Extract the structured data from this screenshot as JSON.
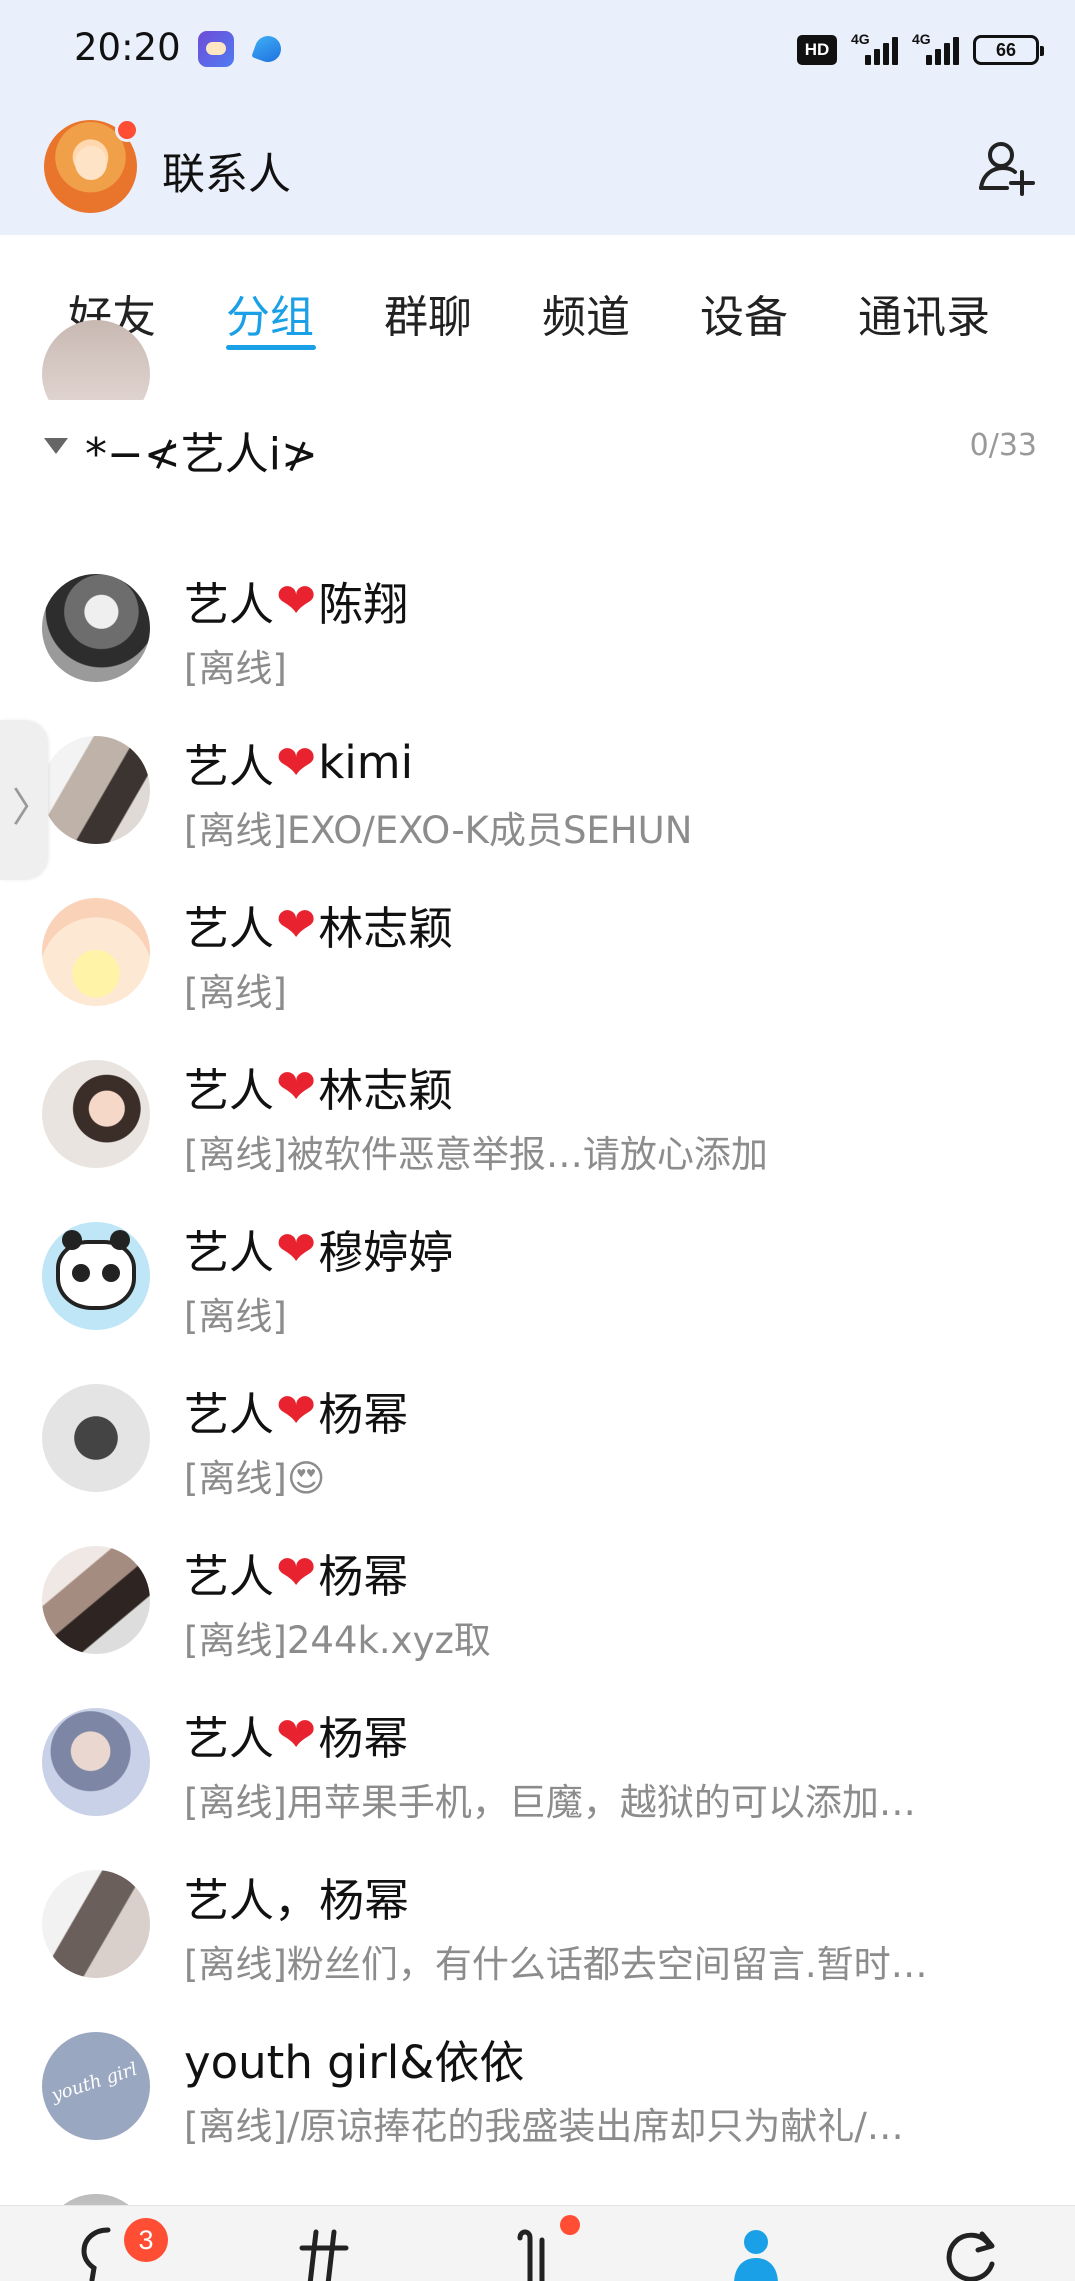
{
  "status_bar": {
    "time": "20:20",
    "hd": "HD",
    "net1": "4G",
    "net2": "4G",
    "battery": "66"
  },
  "header": {
    "title": "联系人"
  },
  "tabs": [
    {
      "label": "好友"
    },
    {
      "label": "分组"
    },
    {
      "label": "群聊"
    },
    {
      "label": "频道"
    },
    {
      "label": "设备"
    },
    {
      "label": "通讯录"
    }
  ],
  "group": {
    "name": "*−≮艺人i≯",
    "count": "0/33"
  },
  "contacts": [
    {
      "prefix": "艺人",
      "heart": "❤",
      "suffix": "陈翔",
      "status": "[离线]"
    },
    {
      "prefix": "艺人",
      "heart": "❤",
      "suffix": "kimi",
      "status": "[离线]EXO/EXO-K成员SEHUN"
    },
    {
      "prefix": "艺人",
      "heart": "❤",
      "suffix": "林志颖",
      "status": "[离线]"
    },
    {
      "prefix": "艺人",
      "heart": "❤",
      "suffix": "林志颖",
      "status": "[离线]被软件恶意举报…请放心添加"
    },
    {
      "prefix": "艺人",
      "heart": "❤",
      "suffix": "穆婷婷",
      "status": "[离线]"
    },
    {
      "prefix": "艺人",
      "heart": "❤",
      "suffix": "杨幂",
      "status": "[离线]😍"
    },
    {
      "prefix": "艺人",
      "heart": "❤",
      "suffix": "杨幂",
      "status": "[离线]244k.xyz取"
    },
    {
      "prefix": "艺人",
      "heart": "❤",
      "suffix": "杨幂",
      "status": "[离线]用苹果手机，巨魔，越狱的可以添加…"
    },
    {
      "prefix": "艺人，杨幂",
      "heart": "",
      "suffix": "",
      "status": "[离线]粉丝们，有什么话都去空间留言.暂时…"
    },
    {
      "prefix": "youth girl&依依",
      "heart": "",
      "suffix": "",
      "status": "[离线]/原谅捧花的我盛装出席却只为献礼/…"
    }
  ],
  "avatar_text": {
    "youth": "youth girl"
  },
  "bottom_nav": {
    "messages_badge": "3"
  },
  "colors": {
    "accent": "#1aa0e6",
    "header_bg": "#eaf0fb",
    "heart": "#e8232f",
    "badge": "#ff4e33"
  },
  "icons": [
    "add-user-icon",
    "caret-down-icon",
    "chat-icon",
    "hash-icon",
    "contacts-icon",
    "refresh-icon"
  ]
}
